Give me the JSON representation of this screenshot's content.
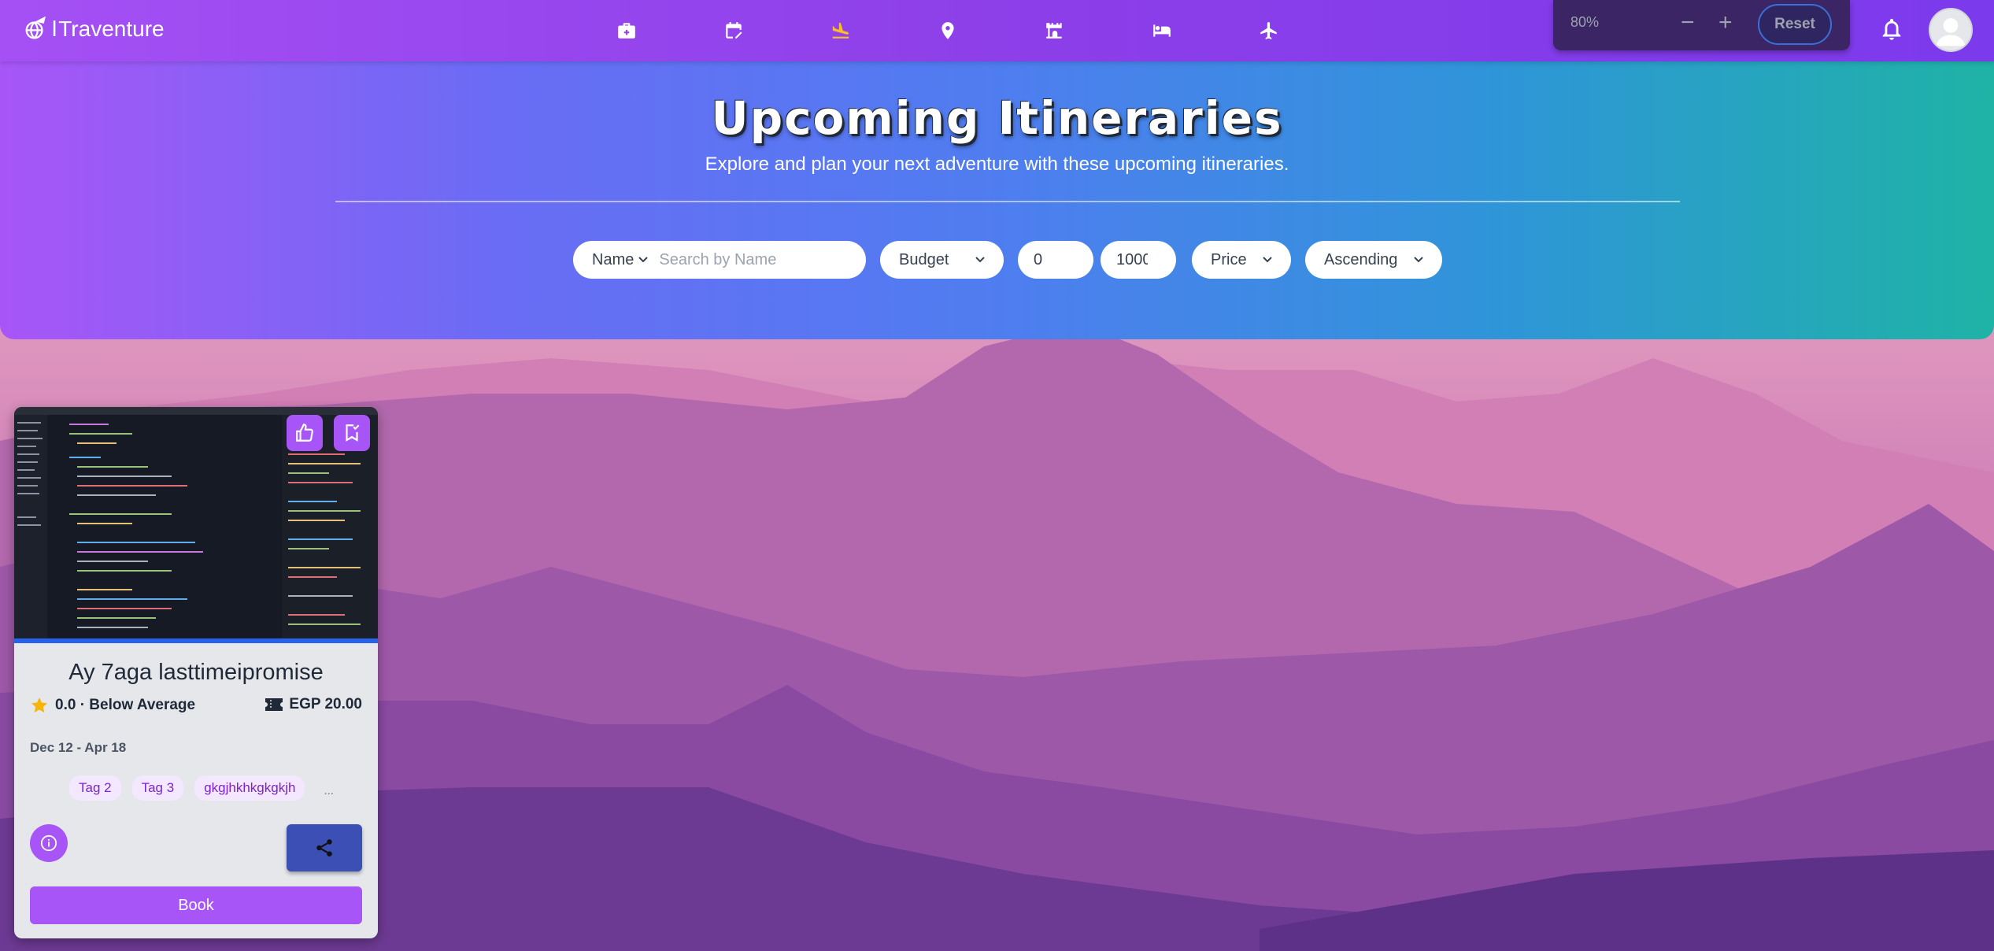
{
  "app": {
    "logo_text": "Traventure",
    "logo_icon": "airplane-globe-icon"
  },
  "nav": {
    "icons": [
      "briefcase-icon",
      "calendar-edit-icon",
      "plane-landing-icon",
      "map-pin-icon",
      "museum-icon",
      "bed-icon",
      "plane-icon"
    ],
    "active_index": 2,
    "active_color": "#fbbf24"
  },
  "zoom": {
    "value": "80%",
    "minus": "−",
    "plus": "+",
    "reset_label": "Reset"
  },
  "hero": {
    "title": "Upcoming Itineraries",
    "subtitle": "Explore and plan your next adventure with these upcoming itineraries."
  },
  "filters": {
    "search_field": "Name",
    "search_placeholder": "Search by Name",
    "budget_label": "Budget",
    "min_value": "0",
    "max_value": "1000",
    "sort_field": "Price",
    "sort_order": "Ascending"
  },
  "card": {
    "title": "Ay 7aga lasttimeipromise",
    "rating": "0.0 · Below Average",
    "price": "EGP 20.00",
    "dates": "Dec 12 - Apr 18",
    "tags": [
      "Tag 2",
      "Tag 3",
      "gkgjhkhkgkgkjh"
    ],
    "tags_more": "...",
    "book_label": "Book"
  },
  "colors": {
    "brand": "#a855f7",
    "share_button": "#3b4fb5",
    "zoom_box": "#3b2565"
  }
}
